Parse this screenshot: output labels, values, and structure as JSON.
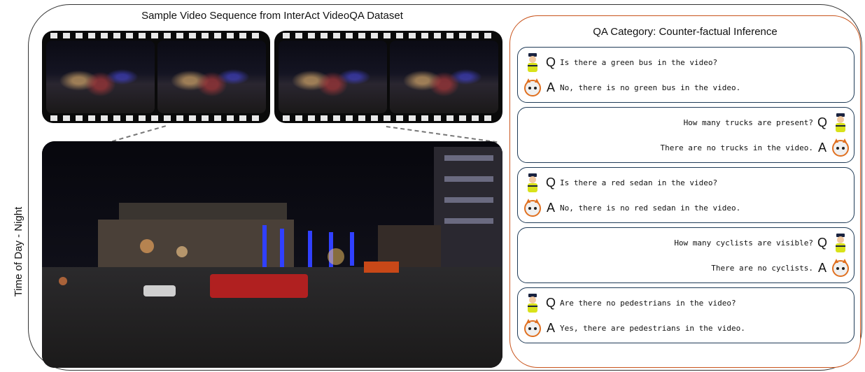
{
  "left_title": "Sample Video Sequence from InterAct VideoQA Dataset",
  "time_label": "Time of Day -  Night",
  "qa_title": "QA Category: Counter-factual Inference",
  "qa_items": [
    {
      "question": "Is there a green bus in the video?",
      "answer": "No, there is no green bus in the video.",
      "q_letter": "Q",
      "a_letter": "A"
    },
    {
      "question": "How many trucks are present?",
      "answer": "There are no trucks in the video.",
      "q_letter": "Q",
      "a_letter": "A"
    },
    {
      "question": "Is there a red sedan in the video?",
      "answer": "No, there is no red sedan in the video.",
      "q_letter": "Q",
      "a_letter": "A"
    },
    {
      "question": "How many cyclists are visible?",
      "answer": "There are no cyclists.",
      "q_letter": "Q",
      "a_letter": "A"
    },
    {
      "question": "Are there no pedestrians in the video?",
      "answer": "Yes, there are pedestrians in the video.",
      "q_letter": "Q",
      "a_letter": "A"
    }
  ],
  "icons": {
    "question": "police-officer-icon",
    "answer": "robot-cat-icon"
  },
  "colors": {
    "qa_panel_border": "#c8541c",
    "card_border": "#1f3b57",
    "outer_border": "#333333"
  }
}
